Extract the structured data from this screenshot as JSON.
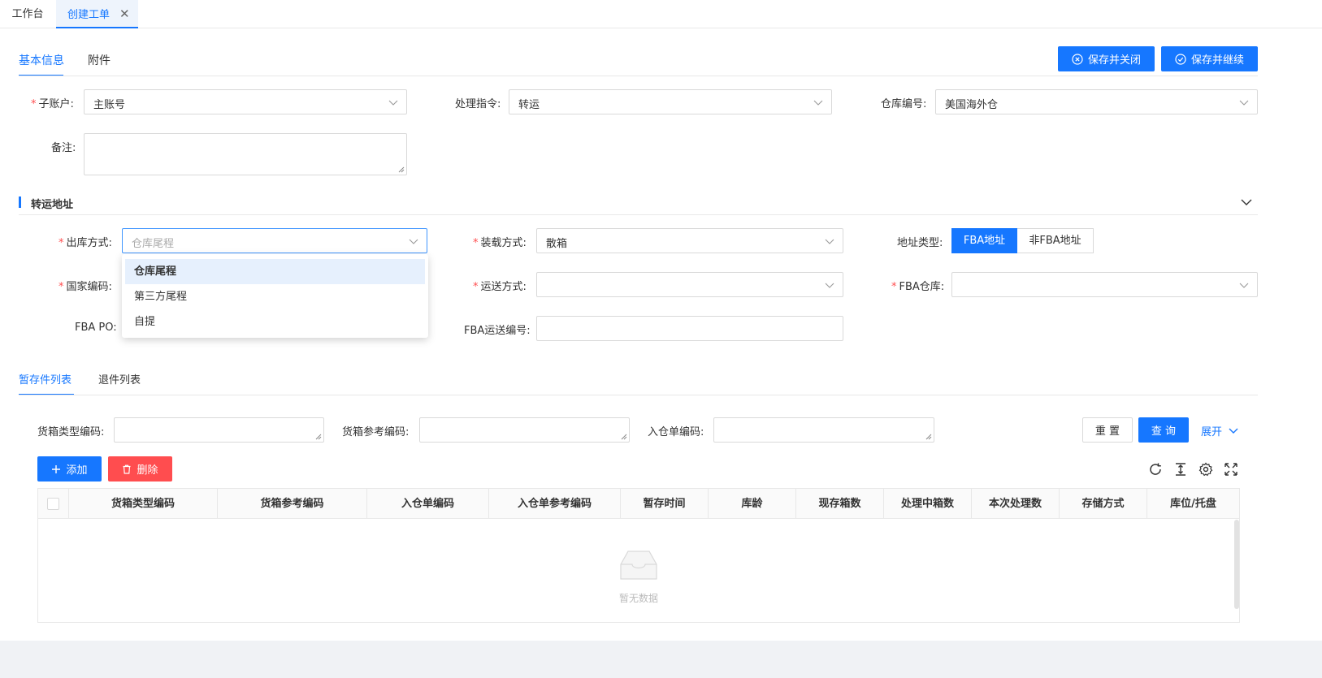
{
  "top_tabs": [
    {
      "label": "工作台"
    },
    {
      "label": "创建工单"
    }
  ],
  "form_tabs": [
    {
      "label": "基本信息"
    },
    {
      "label": "附件"
    }
  ],
  "actions": {
    "save_close": "保存并关闭",
    "save_continue": "保存并继续"
  },
  "basic": {
    "sub_account_label": "子账户:",
    "sub_account_value": "主账号",
    "instruction_label": "处理指令:",
    "instruction_value": "转运",
    "warehouse_label": "仓库编号:",
    "warehouse_value": "美国海外仓",
    "remark_label": "备注:"
  },
  "transfer": {
    "section_title": "转运地址",
    "outbound_label": "出库方式:",
    "outbound_placeholder": "仓库尾程",
    "loading_label": "装载方式:",
    "loading_value": "散箱",
    "address_type_label": "地址类型:",
    "address_type_options": [
      "FBA地址",
      "非FBA地址"
    ],
    "country_label": "国家编码:",
    "ship_method_label": "运送方式:",
    "fba_warehouse_label": "FBA仓库:",
    "fba_po_label": "FBA PO:",
    "fba_ship_no_label": "FBA运送编号:",
    "outbound_options": [
      "仓库尾程",
      "第三方尾程",
      "自提"
    ]
  },
  "list_tabs": [
    {
      "label": "暂存件列表"
    },
    {
      "label": "退件列表"
    }
  ],
  "filters": {
    "box_type_label": "货箱类型编码:",
    "box_ref_label": "货箱参考编码:",
    "inbound_no_label": "入仓单编码:",
    "reset": "重 置",
    "query": "查 询",
    "expand": "展开"
  },
  "table_actions": {
    "add": "添加",
    "delete": "删除"
  },
  "table": {
    "columns": [
      "货箱类型编码",
      "货箱参考编码",
      "入仓单编码",
      "入仓单参考编码",
      "暂存时间",
      "库龄",
      "现存箱数",
      "处理中箱数",
      "本次处理数",
      "存储方式",
      "库位/托盘"
    ],
    "empty_text": "暂无数据"
  },
  "colors": {
    "primary": "#1677ff",
    "danger": "#ff4d4f"
  }
}
